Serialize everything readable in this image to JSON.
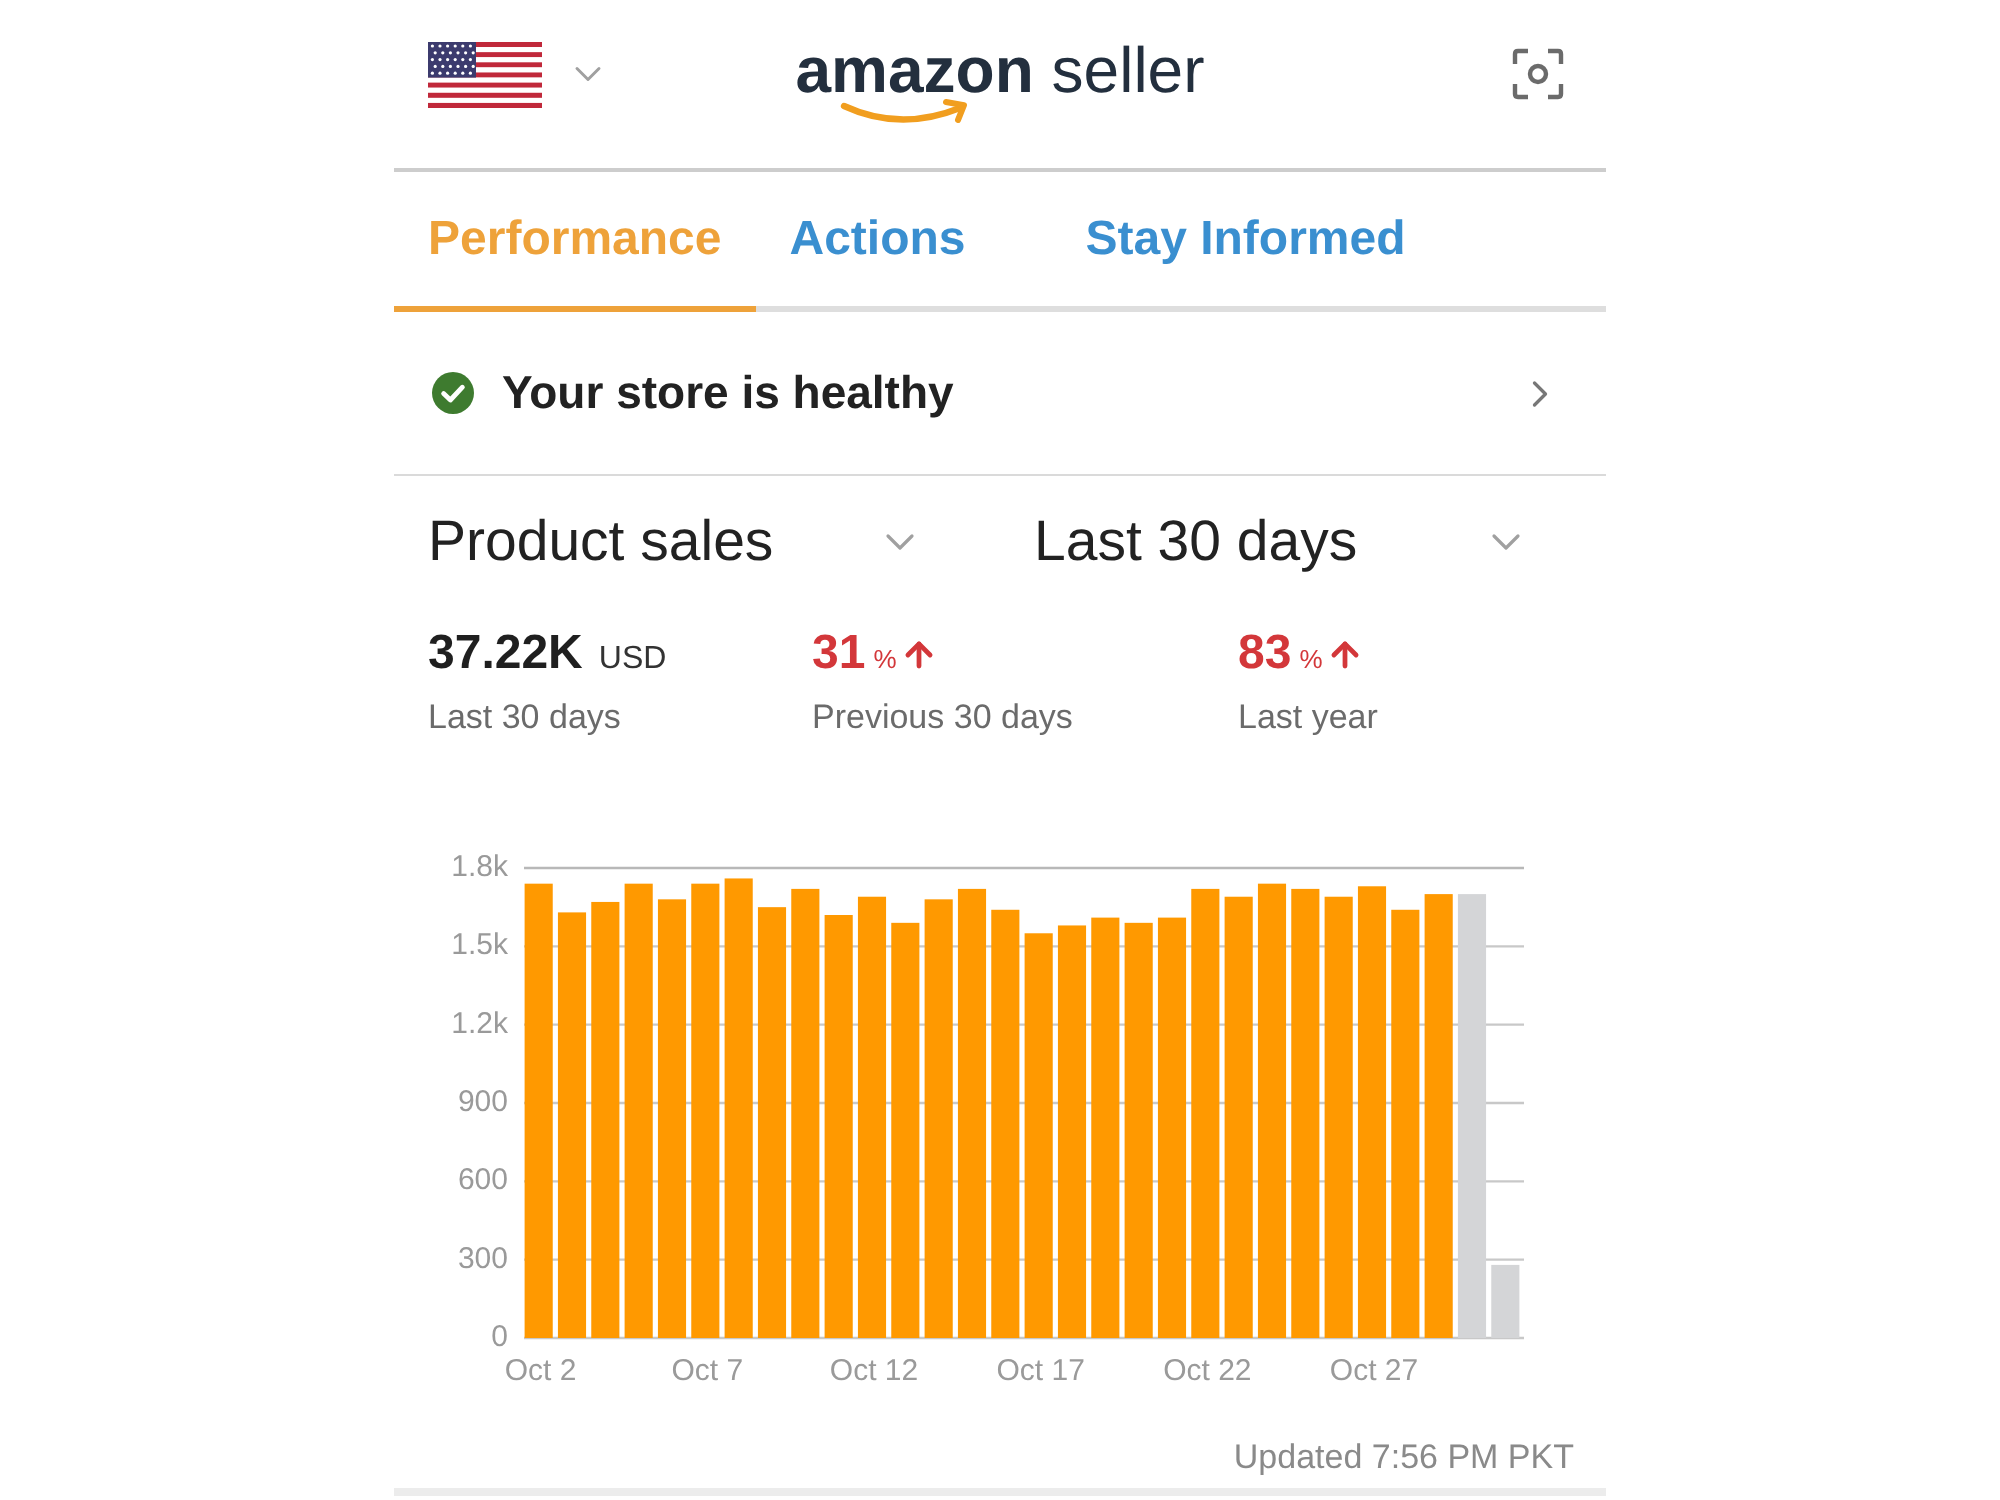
{
  "header": {
    "logo": {
      "brand": "amazon",
      "product": "seller"
    }
  },
  "tabs": [
    {
      "label": "Performance",
      "selected": true
    },
    {
      "label": "Actions",
      "selected": false
    },
    {
      "label": "Stay Informed",
      "selected": false
    }
  ],
  "health": {
    "healthy": true,
    "text": "Your store is healthy"
  },
  "dropdowns": [
    {
      "value": "Product sales"
    },
    {
      "value": "Last 30 days"
    }
  ],
  "metrics": [
    {
      "kind": "amount",
      "value": "37.22K",
      "unit": "USD",
      "label": "Last 30 days"
    },
    {
      "kind": "change",
      "value": "31",
      "unit": "%",
      "up": true,
      "label": "Previous 30 days"
    },
    {
      "kind": "change",
      "value": "83",
      "unit": "%",
      "up": true,
      "label": "Last year"
    }
  ],
  "chart": {
    "chart_data": {
      "type": "bar",
      "categories": [
        "Oct 2",
        null,
        null,
        null,
        null,
        "Oct 7",
        null,
        null,
        null,
        null,
        "Oct 12",
        null,
        null,
        null,
        null,
        "Oct 17",
        null,
        null,
        null,
        null,
        "Oct 22",
        null,
        null,
        null,
        null,
        "Oct 27",
        null,
        null,
        null,
        null
      ],
      "series": [
        {
          "color": "#ff9900",
          "values": [
            1740,
            1630,
            1670,
            1740,
            1680,
            1740,
            1760,
            1650,
            1720,
            1620,
            1690,
            1590,
            1680,
            1720,
            1640,
            1550,
            1580,
            1610,
            1590,
            1610,
            1720,
            1690,
            1740,
            1720,
            1690,
            1730,
            1640,
            1700,
            null,
            null
          ]
        },
        {
          "color": "#d4d5d7",
          "values": [
            null,
            null,
            null,
            null,
            null,
            null,
            null,
            null,
            null,
            null,
            null,
            null,
            null,
            null,
            null,
            null,
            null,
            null,
            null,
            null,
            null,
            null,
            null,
            null,
            null,
            null,
            null,
            null,
            1700,
            280
          ]
        }
      ],
      "ylim": [
        0,
        1800
      ],
      "yticks": [
        0,
        300,
        600,
        900,
        {
          "value": 1200,
          "label": "1.2k"
        },
        {
          "value": 1500,
          "label": "1.5k"
        },
        {
          "value": 1800,
          "label": "1.8k"
        }
      ],
      "grid": true
    },
    "updated": "Updated 7:56 PM PKT"
  }
}
